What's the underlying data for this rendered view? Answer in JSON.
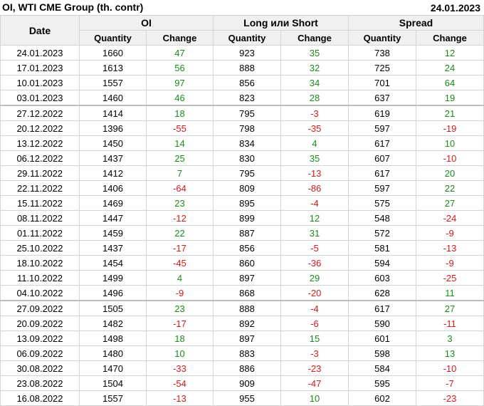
{
  "header": {
    "title": "OI, WTI CME Group (th. contr)",
    "date": "24.01.2023"
  },
  "columns": {
    "date": "Date",
    "groups": [
      "OI",
      "Long или Short",
      "Spread"
    ],
    "sub": [
      "Quantity",
      "Change",
      "Quantity",
      "Change",
      "Quantity",
      "Change"
    ]
  },
  "colors": {
    "positive": "#1a8a1a",
    "negative": "#d41a1a"
  },
  "rows": [
    [
      "24.01.2023",
      "1660",
      "47",
      "923",
      "35",
      "738",
      "12"
    ],
    [
      "17.01.2023",
      "1613",
      "56",
      "888",
      "32",
      "725",
      "24"
    ],
    [
      "10.01.2023",
      "1557",
      "97",
      "856",
      "34",
      "701",
      "64"
    ],
    [
      "03.01.2023",
      "1460",
      "46",
      "823",
      "28",
      "637",
      "19"
    ],
    [
      "27.12.2022",
      "1414",
      "18",
      "795",
      "-3",
      "619",
      "21"
    ],
    [
      "20.12.2022",
      "1396",
      "-55",
      "798",
      "-35",
      "597",
      "-19"
    ],
    [
      "13.12.2022",
      "1450",
      "14",
      "834",
      "4",
      "617",
      "10"
    ],
    [
      "06.12.2022",
      "1437",
      "25",
      "830",
      "35",
      "607",
      "-10"
    ],
    [
      "29.11.2022",
      "1412",
      "7",
      "795",
      "-13",
      "617",
      "20"
    ],
    [
      "22.11.2022",
      "1406",
      "-64",
      "809",
      "-86",
      "597",
      "22"
    ],
    [
      "15.11.2022",
      "1469",
      "23",
      "895",
      "-4",
      "575",
      "27"
    ],
    [
      "08.11.2022",
      "1447",
      "-12",
      "899",
      "12",
      "548",
      "-24"
    ],
    [
      "01.11.2022",
      "1459",
      "22",
      "887",
      "31",
      "572",
      "-9"
    ],
    [
      "25.10.2022",
      "1437",
      "-17",
      "856",
      "-5",
      "581",
      "-13"
    ],
    [
      "18.10.2022",
      "1454",
      "-45",
      "860",
      "-36",
      "594",
      "-9"
    ],
    [
      "11.10.2022",
      "1499",
      "4",
      "897",
      "29",
      "603",
      "-25"
    ],
    [
      "04.10.2022",
      "1496",
      "-9",
      "868",
      "-20",
      "628",
      "11"
    ],
    [
      "27.09.2022",
      "1505",
      "23",
      "888",
      "-4",
      "617",
      "27"
    ],
    [
      "20.09.2022",
      "1482",
      "-17",
      "892",
      "-6",
      "590",
      "-11"
    ],
    [
      "13.09.2022",
      "1498",
      "18",
      "897",
      "15",
      "601",
      "3"
    ],
    [
      "06.09.2022",
      "1480",
      "10",
      "883",
      "-3",
      "598",
      "13"
    ],
    [
      "30.08.2022",
      "1470",
      "-33",
      "886",
      "-23",
      "584",
      "-10"
    ],
    [
      "23.08.2022",
      "1504",
      "-54",
      "909",
      "-47",
      "595",
      "-7"
    ],
    [
      "16.08.2022",
      "1557",
      "-13",
      "955",
      "10",
      "602",
      "-23"
    ]
  ]
}
